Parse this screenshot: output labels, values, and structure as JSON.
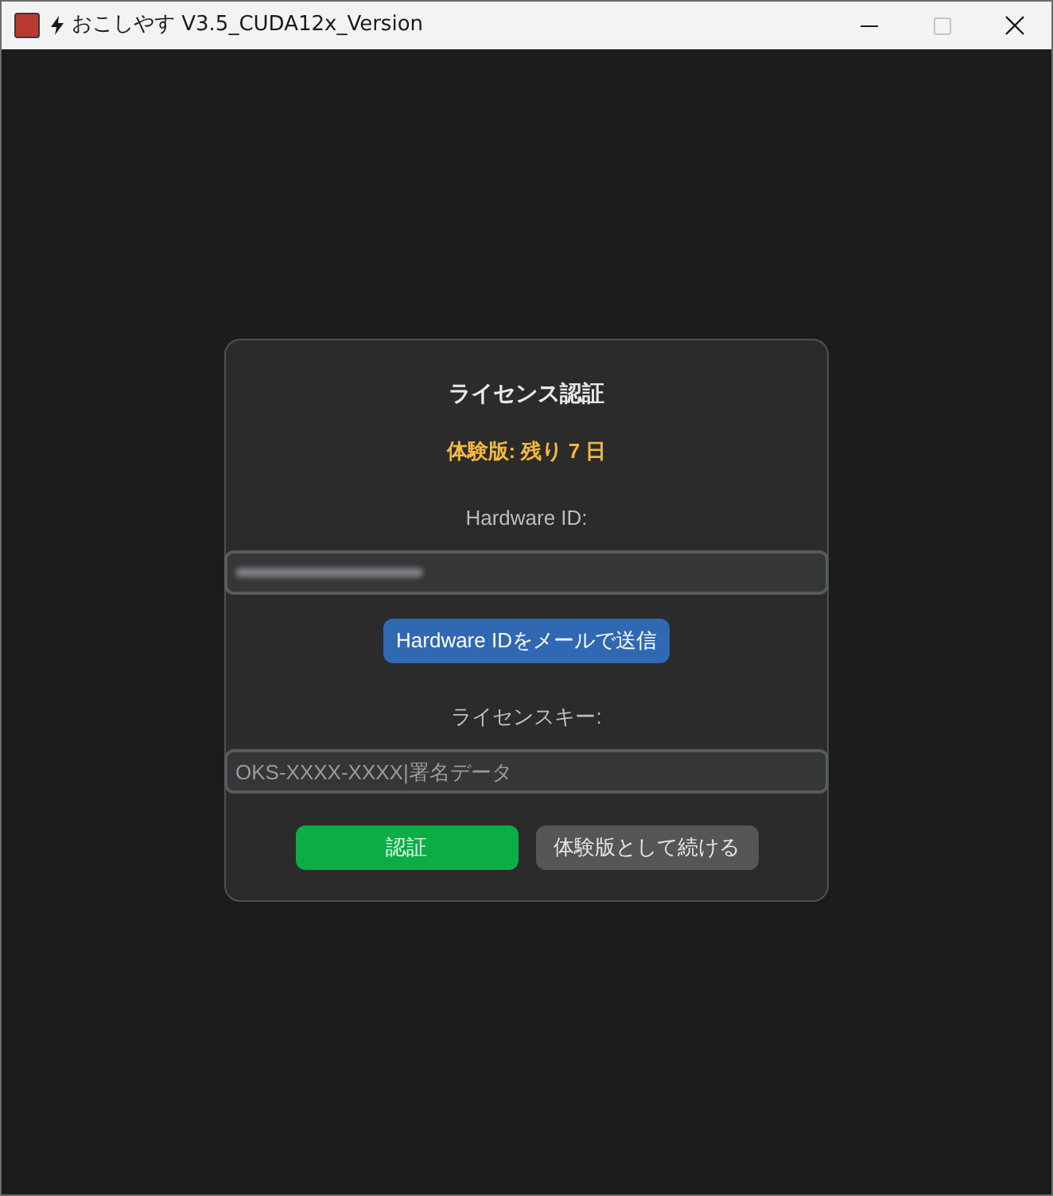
{
  "window": {
    "title": "おこしやす V3.5_CUDA12x_Version",
    "controls": [
      {
        "kind": "minimize",
        "disabled": false
      },
      {
        "kind": "maximize",
        "disabled": true
      },
      {
        "kind": "close",
        "disabled": false
      }
    ]
  },
  "dialog": {
    "title": "ライセンス認証",
    "trial_status": "体験版: 残り 7 日",
    "hardware_id_label": "Hardware ID:",
    "hardware_id_field": {
      "value_hidden": true
    },
    "send_button": "Hardware IDをメールで送信",
    "license_key_label": "ライセンスキー:",
    "license_key_field": {
      "placeholder": "OKS-XXXX-XXXX|署名データ"
    },
    "buttons": [
      {
        "kind": "primary",
        "label": "認証"
      },
      {
        "kind": "secondary",
        "label": "体験版として続ける"
      }
    ]
  }
}
